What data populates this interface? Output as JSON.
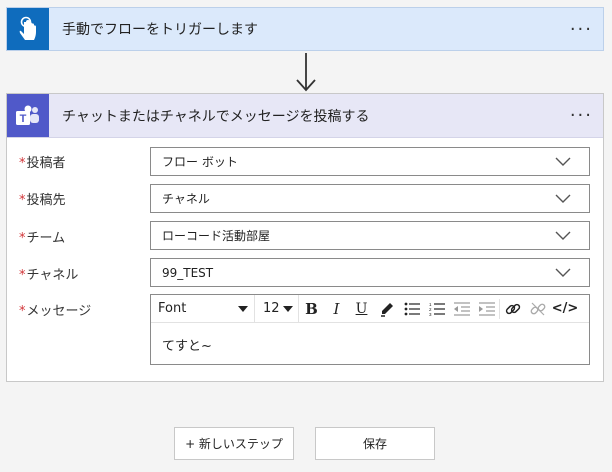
{
  "trigger": {
    "title": "手動でフローをトリガーします",
    "more": "···",
    "icon": "hand-tap-icon"
  },
  "action": {
    "title": "チャットまたはチャネルでメッセージを投稿する",
    "more": "···",
    "icon": "teams-icon",
    "required_mark": "*",
    "fields": [
      {
        "label": "投稿者",
        "value": "フロー ボット"
      },
      {
        "label": "投稿先",
        "value": "チャネル"
      },
      {
        "label": "チーム",
        "value": "ローコード活動部屋"
      },
      {
        "label": "チャネル",
        "value": "99_TEST"
      }
    ],
    "message": {
      "label": "メッセージ",
      "font": "Font",
      "size": "12",
      "bold": "B",
      "italic": "I",
      "underline": "U",
      "code": "</>",
      "body": "てすと~"
    }
  },
  "buttons": {
    "new_step": "+ 新しいステップ",
    "save": "保存"
  },
  "colors": {
    "trigger_icon_bg": "#0f6cbd",
    "teams_icon_bg": "#5059c9",
    "required": "#d13438"
  }
}
